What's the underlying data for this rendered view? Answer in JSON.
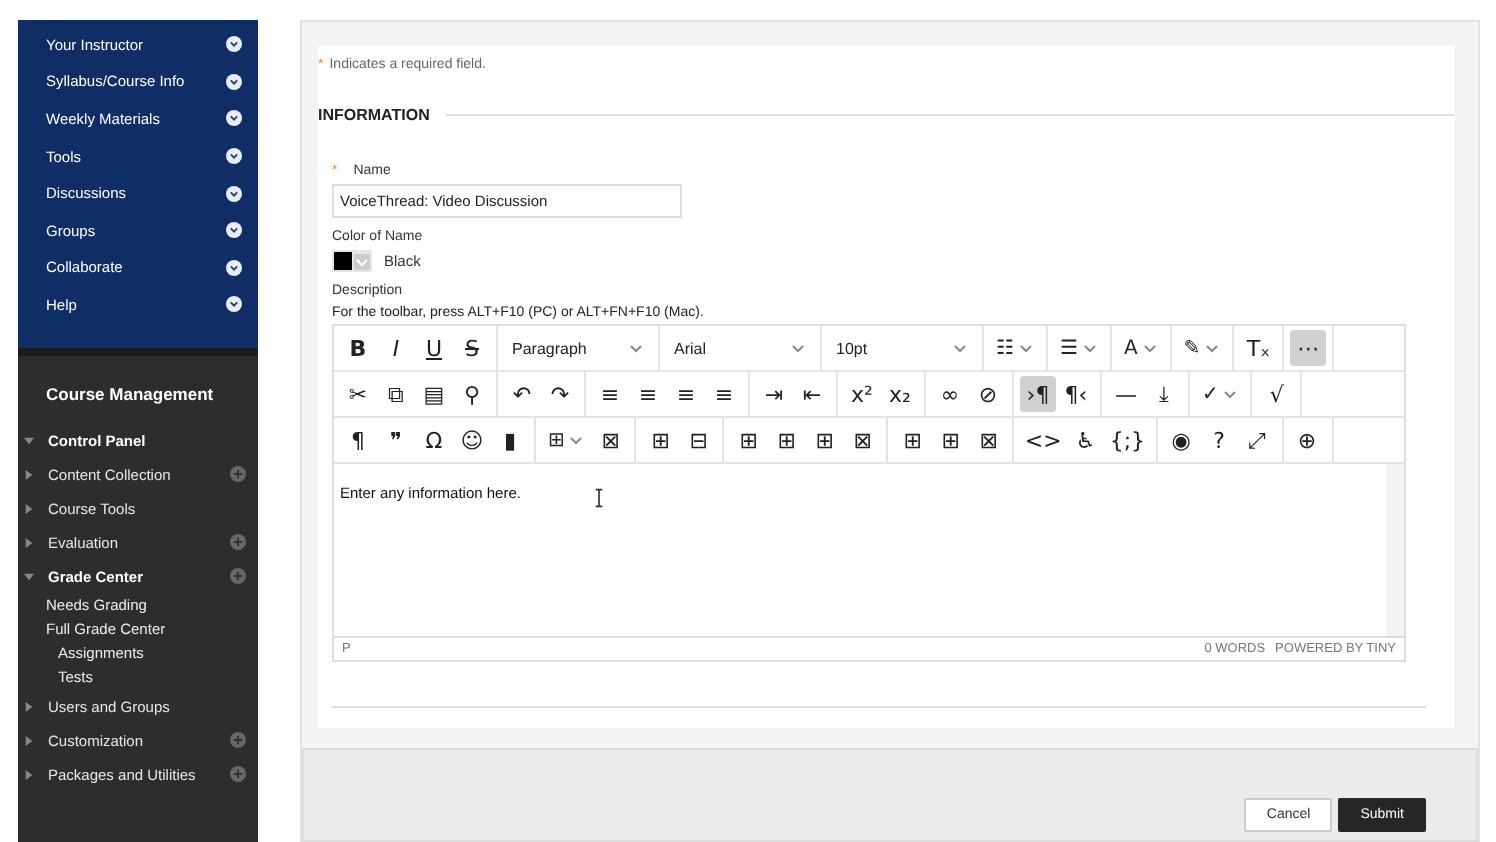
{
  "course_menu": [
    {
      "label": "Your Instructor"
    },
    {
      "label": "Syllabus/Course Info"
    },
    {
      "label": "Weekly Materials"
    },
    {
      "label": "Tools"
    },
    {
      "label": "Discussions"
    },
    {
      "label": "Groups"
    },
    {
      "label": "Collaborate"
    },
    {
      "label": "Help"
    }
  ],
  "management": {
    "title": "Course Management",
    "tree": [
      {
        "label": "Control Panel",
        "expanded": true,
        "children": [
          {
            "label": "Content Collection",
            "expanded": false,
            "action": true
          },
          {
            "label": "Course Tools",
            "expanded": false,
            "action": false
          },
          {
            "label": "Evaluation",
            "expanded": false,
            "action": true
          },
          {
            "label": "Grade Center",
            "expanded": true,
            "action": true,
            "children": [
              {
                "label": "Needs Grading"
              },
              {
                "label": "Full Grade Center",
                "children": [
                  {
                    "label": "Assignments"
                  },
                  {
                    "label": "Tests"
                  }
                ]
              }
            ]
          },
          {
            "label": "Users and Groups",
            "expanded": false,
            "action": false
          },
          {
            "label": "Customization",
            "expanded": false,
            "action": true
          },
          {
            "label": "Packages and Utilities",
            "expanded": false,
            "action": true
          }
        ]
      }
    ]
  },
  "form": {
    "required_mark": "*",
    "required_note": "Indicates a required field.",
    "section": "INFORMATION",
    "name": {
      "label": "Name",
      "required": true,
      "value": "VoiceThread: Video Discussion"
    },
    "color": {
      "label": "Color of Name",
      "value": "Black",
      "color": "#000000"
    },
    "description": {
      "label": "Description",
      "hint": "For the toolbar, press ALT+F10 (PC) or ALT+FN+F10 (Mac).",
      "toolbar": [
        [
          [
            {
              "kind": "button",
              "label": "B",
              "active": false
            },
            {
              "kind": "button",
              "label": "I",
              "active": false
            },
            {
              "kind": "button",
              "label": "U",
              "active": false
            },
            {
              "kind": "button",
              "label": "S",
              "active": false
            }
          ],
          [
            {
              "kind": "select",
              "label": "Paragraph"
            }
          ],
          [
            {
              "kind": "select",
              "label": "Arial"
            }
          ],
          [
            {
              "kind": "select",
              "label": "10pt"
            }
          ],
          [
            {
              "kind": "split",
              "label": "☷"
            }
          ],
          [
            {
              "kind": "split",
              "label": "☰"
            }
          ],
          [
            {
              "kind": "split",
              "label": "A"
            }
          ],
          [
            {
              "kind": "split",
              "label": "✎"
            }
          ],
          [
            {
              "kind": "button",
              "label": "Tₓ",
              "active": false
            }
          ],
          [
            {
              "kind": "button",
              "label": "⋯",
              "active": true
            }
          ]
        ],
        [
          [
            {
              "kind": "button",
              "label": "✂",
              "active": false
            },
            {
              "kind": "button",
              "label": "⧉",
              "active": false
            },
            {
              "kind": "button",
              "label": "▤",
              "active": false
            },
            {
              "kind": "button",
              "label": "⚲",
              "active": false
            }
          ],
          [
            {
              "kind": "button",
              "label": "↶",
              "active": false
            },
            {
              "kind": "button",
              "label": "↷",
              "active": false
            }
          ],
          [
            {
              "kind": "button",
              "label": "≡",
              "active": false
            },
            {
              "kind": "button",
              "label": "≡",
              "active": false
            },
            {
              "kind": "button",
              "label": "≡",
              "active": false
            },
            {
              "kind": "button",
              "label": "≡",
              "active": false
            }
          ],
          [
            {
              "kind": "button",
              "label": "⇥",
              "active": false
            },
            {
              "kind": "button",
              "label": "⇤",
              "active": false
            }
          ],
          [
            {
              "kind": "button",
              "label": "x²",
              "active": false
            },
            {
              "kind": "button",
              "label": "x₂",
              "active": false
            }
          ],
          [
            {
              "kind": "button",
              "label": "∞",
              "active": false
            },
            {
              "kind": "button",
              "label": "⊘",
              "active": false
            }
          ],
          [
            {
              "kind": "button",
              "label": "›¶",
              "active": true
            },
            {
              "kind": "button",
              "label": "¶‹",
              "active": false
            }
          ],
          [
            {
              "kind": "button",
              "label": "—",
              "active": false
            },
            {
              "kind": "button",
              "label": "⤓",
              "active": false
            }
          ],
          [
            {
              "kind": "split",
              "label": "✓"
            }
          ],
          [
            {
              "kind": "button",
              "label": "√",
              "active": false
            }
          ]
        ],
        [
          [
            {
              "kind": "button",
              "label": "¶",
              "active": false
            },
            {
              "kind": "button",
              "label": "❞",
              "active": false
            },
            {
              "kind": "button",
              "label": "Ω",
              "active": false
            },
            {
              "kind": "button",
              "label": "☺",
              "active": false
            },
            {
              "kind": "button",
              "label": "▮",
              "active": false
            }
          ],
          [
            {
              "kind": "split",
              "label": "⊞"
            },
            {
              "kind": "button",
              "label": "⊠",
              "active": false
            }
          ],
          [
            {
              "kind": "button",
              "label": "⊞",
              "active": false
            },
            {
              "kind": "button",
              "label": "⊟",
              "active": false
            }
          ],
          [
            {
              "kind": "button",
              "label": "⊞",
              "active": false
            },
            {
              "kind": "button",
              "label": "⊞",
              "active": false
            },
            {
              "kind": "button",
              "label": "⊞",
              "active": false
            },
            {
              "kind": "button",
              "label": "⊠",
              "active": false
            }
          ],
          [
            {
              "kind": "button",
              "label": "⊞",
              "active": false
            },
            {
              "kind": "button",
              "label": "⊞",
              "active": false
            },
            {
              "kind": "button",
              "label": "⊠",
              "active": false
            }
          ],
          [
            {
              "kind": "button",
              "label": "<>",
              "active": false
            },
            {
              "kind": "button",
              "label": "♿",
              "active": false
            },
            {
              "kind": "button",
              "label": "{;}",
              "active": false
            }
          ],
          [
            {
              "kind": "button",
              "label": "◉",
              "active": false
            },
            {
              "kind": "button",
              "label": "?",
              "active": false
            },
            {
              "kind": "button",
              "label": "⤢",
              "active": false
            }
          ],
          [
            {
              "kind": "button",
              "label": "⊕",
              "active": false
            }
          ]
        ]
      ],
      "content": "Enter any information here.",
      "path": "P",
      "word_count": "0 WORDS",
      "powered_by": "POWERED BY TINY"
    }
  },
  "buttons": [
    {
      "kind": "secondary",
      "label": "Cancel"
    },
    {
      "kind": "primary",
      "label": "Submit"
    }
  ]
}
